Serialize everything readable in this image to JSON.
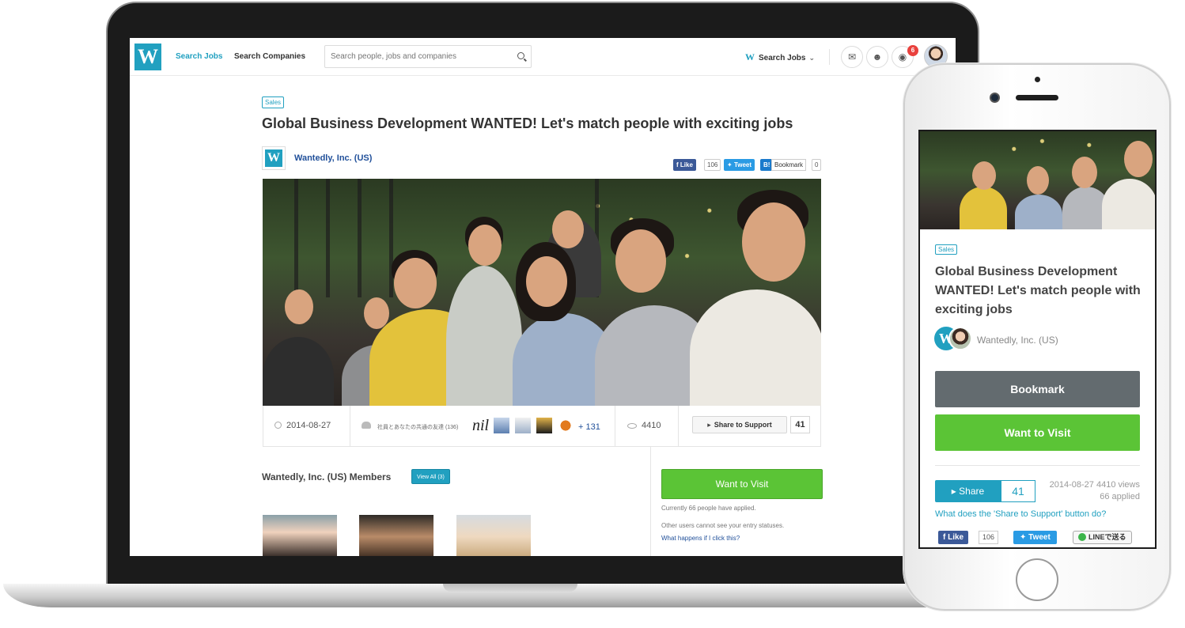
{
  "laptop": {
    "header": {
      "logo_letter": "W",
      "nav_search_jobs": "Search Jobs",
      "nav_search_companies": "Search Companies",
      "search_placeholder": "Search people, jobs and companies",
      "right_menu_label": "Search Jobs",
      "notification_count": "6"
    },
    "job": {
      "tag": "Sales",
      "title": "Global Business Development WANTED! Let's match people with exciting jobs",
      "company_name": "Wantedly, Inc. (US)",
      "social": {
        "fb_label": "Like",
        "fb_count": "106",
        "tw_label": "Tweet",
        "hb_label": "B!",
        "hb_text": "Bookmark",
        "hb_count": "0"
      }
    },
    "stats": {
      "date": "2014-08-27",
      "friends_text": "社員とあなたの共通の友達 (136)",
      "nil_text": "nil",
      "plus_count": "+ 131",
      "views": "4410",
      "share_label": "Share to Support",
      "share_count": "41"
    },
    "members": {
      "title": "Wantedly, Inc. (US) Members",
      "view_all": "View All (3)"
    },
    "apply": {
      "visit_label": "Want to Visit",
      "applied_text": "Currently 66 people have applied.",
      "other_text": "Other users cannot see your entry statuses.",
      "what_link": "What happens if I click this?"
    }
  },
  "phone": {
    "tag": "Sales",
    "title": "Global Business Development WANTED! Let's match people with exciting jobs",
    "avatar_letter": "W",
    "company_name": "Wantedly, Inc. (US)",
    "bookmark_label": "Bookmark",
    "visit_label": "Want to Visit",
    "share_label": "Share",
    "share_count": "41",
    "meta_line1": "2014-08-27 4410 views",
    "meta_line2": "66 applied",
    "what_link": "What does the 'Share to Support' button do?",
    "fb_label": "Like",
    "fb_count": "106",
    "tw_label": "Tweet",
    "line_label": "LINEで送る"
  },
  "colors": {
    "brand": "#21a0c0",
    "green": "#5bc436",
    "facebook": "#3b5998",
    "twitter": "#2a9be4",
    "badge": "#e9413d"
  },
  "icons": {
    "search": "search-icon",
    "chat": "chat-icon",
    "user": "user-icon",
    "globe": "globe-icon",
    "clock": "clock-icon",
    "people": "people-icon",
    "eye": "eye-icon",
    "megaphone": "megaphone-icon"
  }
}
